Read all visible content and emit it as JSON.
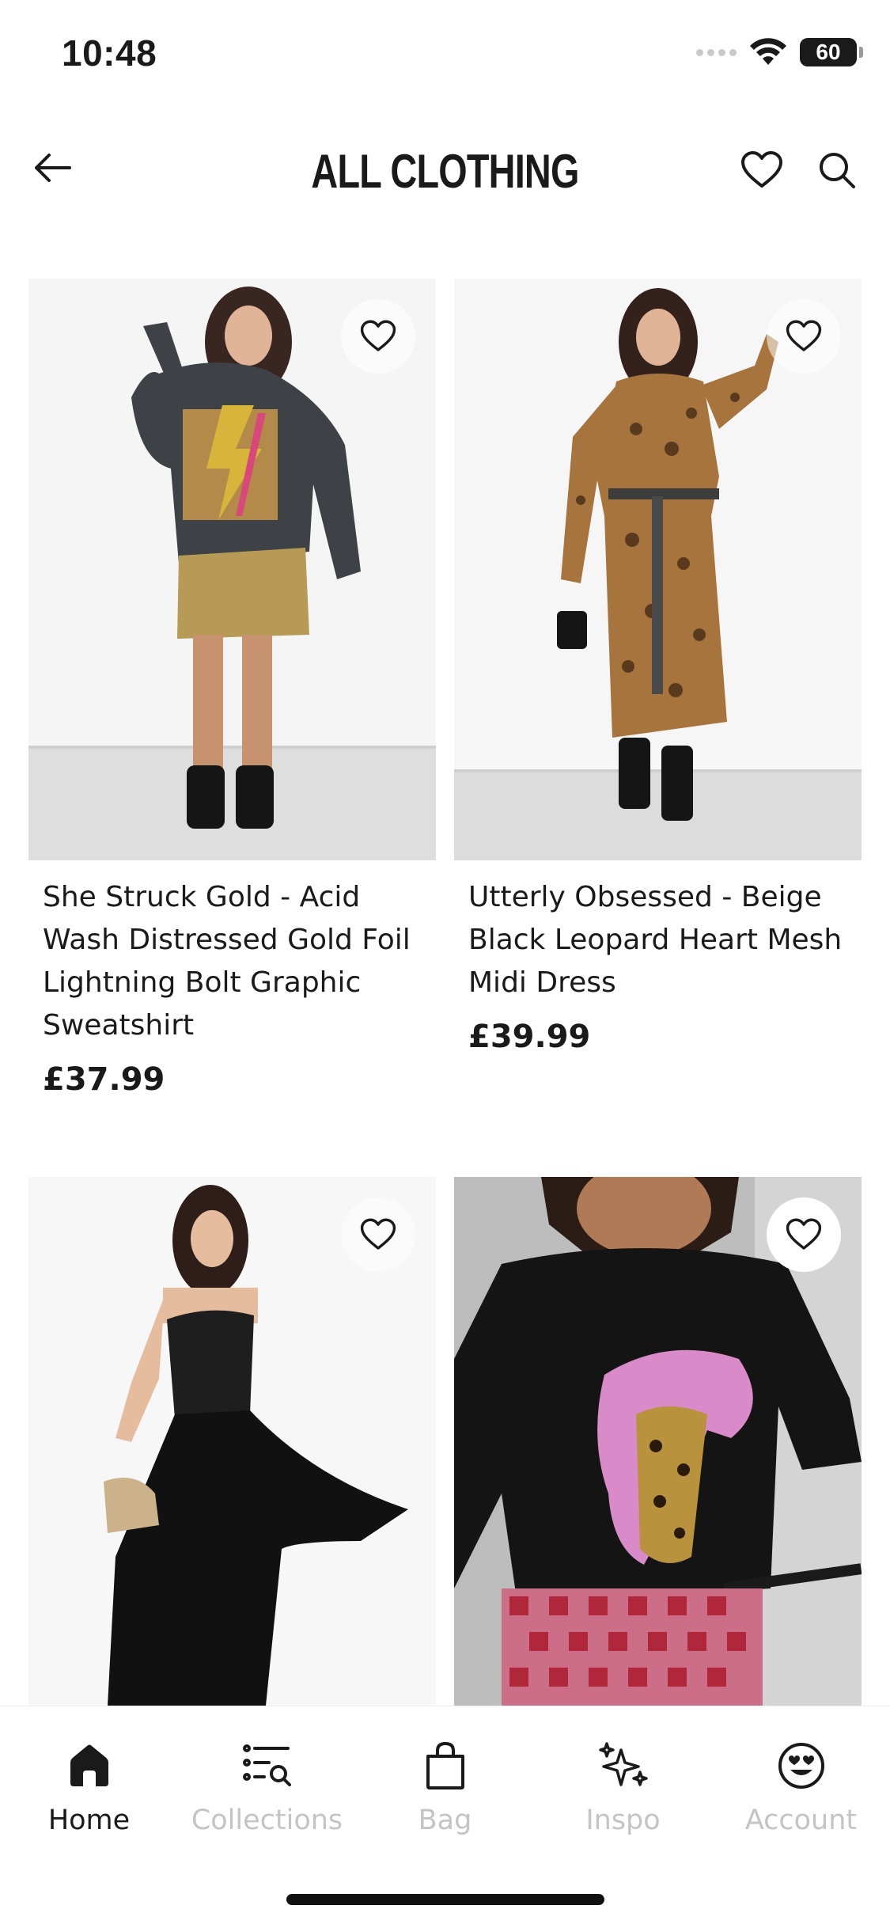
{
  "status": {
    "time": "10:48",
    "battery": "60"
  },
  "header": {
    "title": "ALL CLOTHING"
  },
  "products": [
    {
      "name": "She Struck Gold - Acid Wash Distressed Gold Foil Lightning Bolt Graphic Sweatshirt",
      "price": "£37.99"
    },
    {
      "name": "Utterly Obsessed - Beige Black Leopard Heart Mesh Midi Dress",
      "price": "£39.99"
    },
    {
      "name": "",
      "price": ""
    },
    {
      "name": "",
      "price": ""
    }
  ],
  "tabs": [
    {
      "label": "Home",
      "icon": "home-icon",
      "active": true
    },
    {
      "label": "Collections",
      "icon": "collections-icon",
      "active": false
    },
    {
      "label": "Bag",
      "icon": "bag-icon",
      "active": false
    },
    {
      "label": "Inspo",
      "icon": "sparkles-icon",
      "active": false
    },
    {
      "label": "Account",
      "icon": "smiley-icon",
      "active": false
    }
  ],
  "colors": {
    "text": "#1a1a1a",
    "inactive_tab": "#c4c4c4",
    "background": "#ffffff"
  }
}
